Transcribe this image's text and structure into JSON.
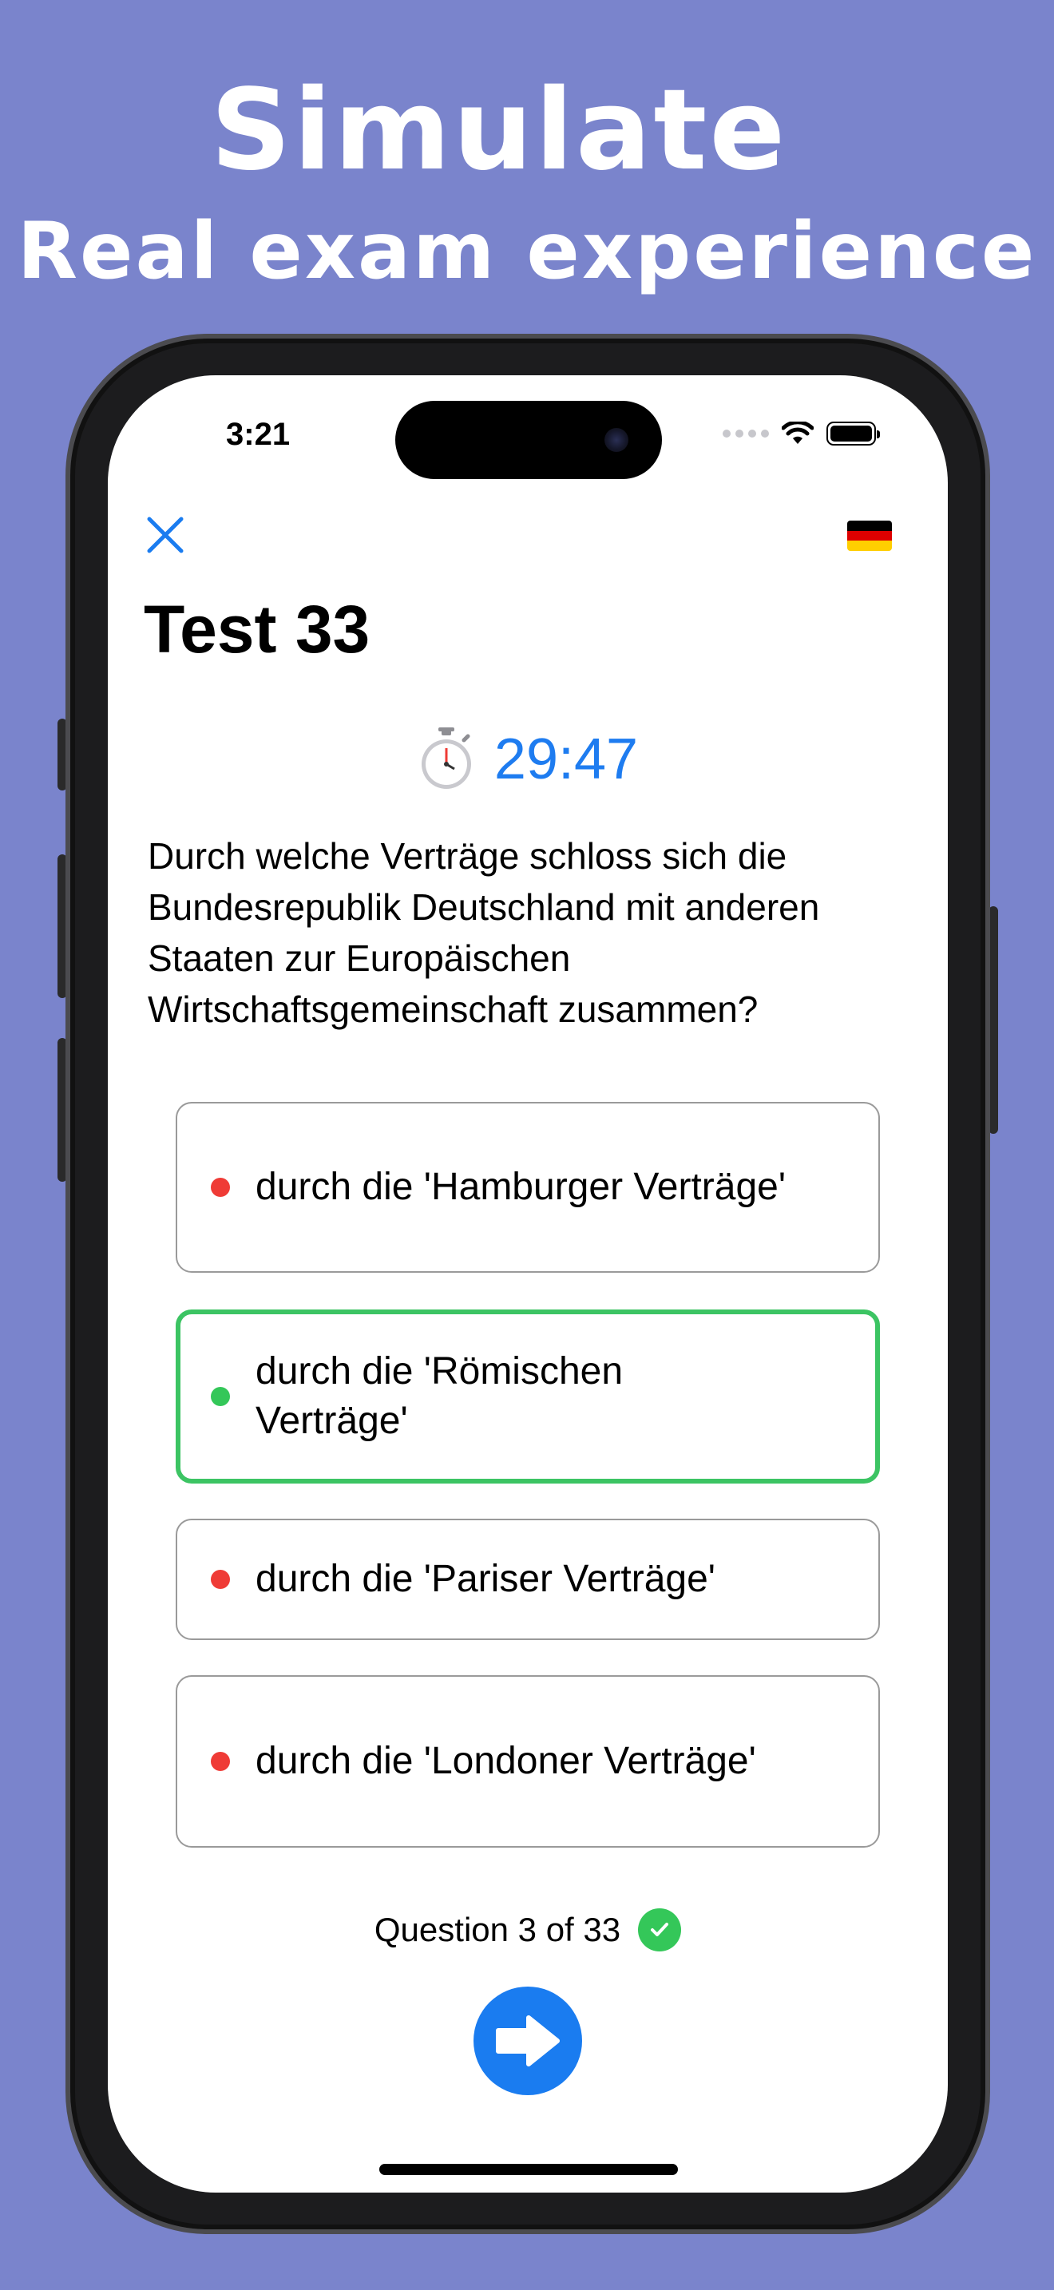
{
  "promo": {
    "headline_1": "Simulate",
    "headline_2": "Real exam experience"
  },
  "status_bar": {
    "time": "3:21"
  },
  "nav": {
    "close_icon": "close-icon",
    "language_flag": "germany-flag-icon"
  },
  "exam": {
    "title": "Test 33",
    "timer": "29:47",
    "question": "Durch welche Verträge schloss sich die Bundesrepublik Deutschland mit anderen Staaten zur Europäischen Wirtschaftsgemeinschaft zusammen?",
    "answers": [
      {
        "label": "durch die 'Hamburger Verträge'",
        "correct": false
      },
      {
        "label": "durch die 'Römischen Verträge'",
        "correct": true,
        "selected": true
      },
      {
        "label": "durch die 'Pariser Verträge'",
        "correct": false
      },
      {
        "label": "durch die 'Londoner Verträge'",
        "correct": false
      }
    ],
    "progress_text": "Question 3 of 33"
  },
  "colors": {
    "background": "#7a84cc",
    "accent": "#1a7cf0",
    "correct": "#34c759",
    "wrong": "#ef3b36"
  }
}
